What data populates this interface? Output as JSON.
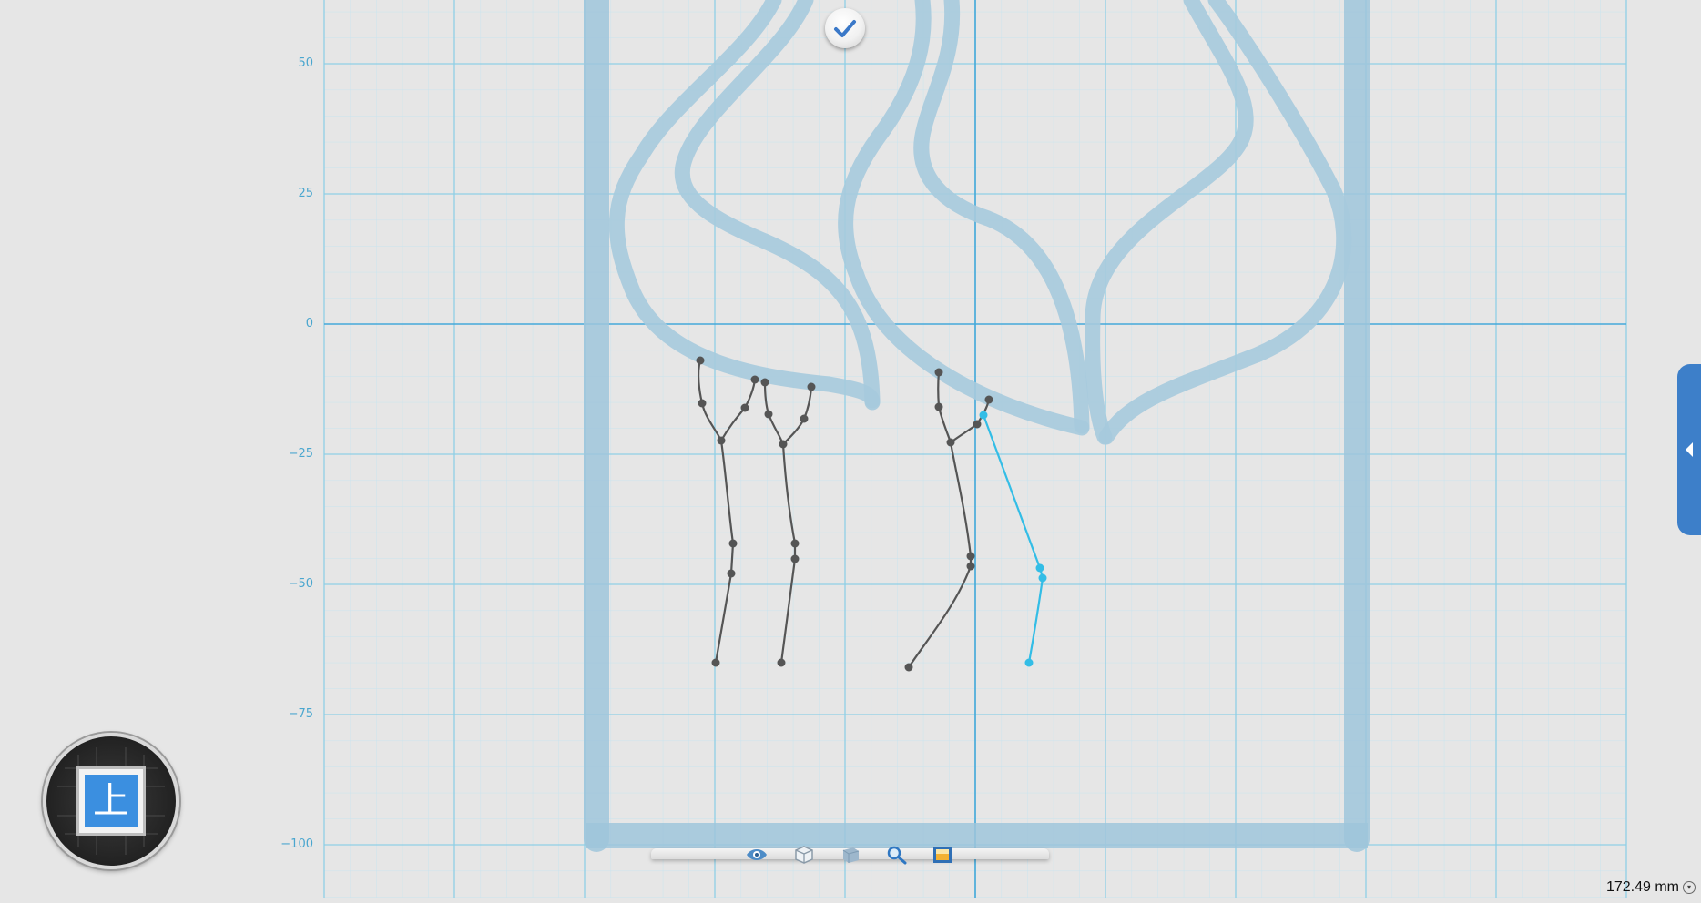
{
  "axis": {
    "y_labels": [
      "50",
      "25",
      "0",
      "−25",
      "−50",
      "−75",
      "−100"
    ]
  },
  "view_cube": {
    "face_label": "上"
  },
  "toolbar": {
    "tools": [
      {
        "name": "view-icon"
      },
      {
        "name": "cube-icon"
      },
      {
        "name": "shaded-box-icon"
      },
      {
        "name": "magnify-icon"
      },
      {
        "name": "image-frame-icon"
      }
    ]
  },
  "status": {
    "measurement": "172.49 mm"
  },
  "colors": {
    "grid_minor": "#c6e3ee",
    "grid_major": "#8ccde6",
    "axis_line": "#45a9da",
    "tube": "#9fc6db",
    "skeleton": "#555555",
    "skeleton_selected": "#33bde6",
    "accent": "#3d7fc9"
  }
}
